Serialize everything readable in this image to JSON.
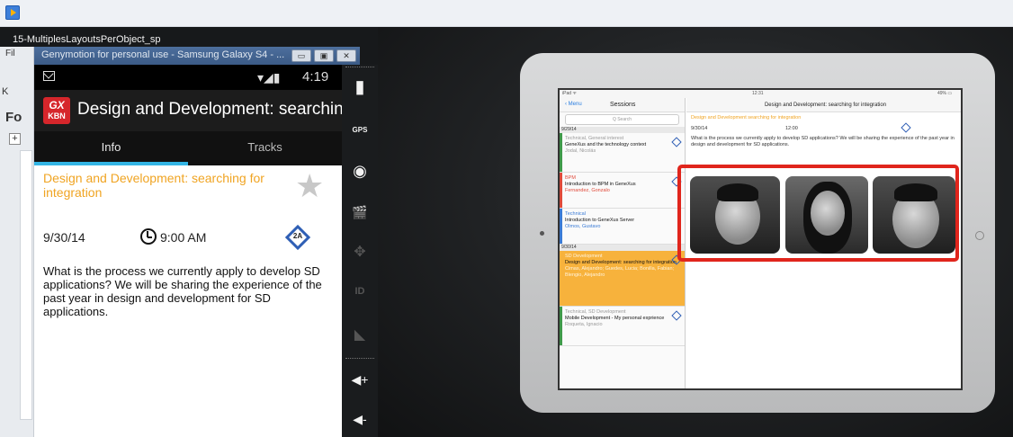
{
  "top_bar": {
    "app_icon": "video-player-icon"
  },
  "video_title": "15-MultiplesLayoutsPerObject_sp",
  "ide": {
    "file_menu": "Fil",
    "k_tab": "K",
    "fo_label": "Fo",
    "expand": "+"
  },
  "genymotion": {
    "window_title": "Genymotion for personal use - Samsung Galaxy S4 - ...",
    "buttons": [
      "▭",
      "▣",
      "✕"
    ]
  },
  "phone": {
    "status": {
      "time": "4:19",
      "signal": "▾◢▮"
    },
    "action_bar": {
      "logo_top": "GX",
      "logo_bottom": "KBN",
      "title": "Design and Development: searching..."
    },
    "tabs": [
      {
        "label": "Info",
        "active": true
      },
      {
        "label": "Tracks",
        "active": false
      }
    ],
    "session": {
      "title": "Design and Development: searching for integration",
      "date": "9/30/14",
      "time": "9:00 AM",
      "room": "2A",
      "description": "What is the process we currently apply to develop SD applications? We will be sharing the experience of the past year in design and development for SD applications."
    }
  },
  "side_controls": [
    {
      "name": "battery-icon",
      "glyph": "▮"
    },
    {
      "name": "gps-icon",
      "glyph": "GPS"
    },
    {
      "name": "camera-icon",
      "glyph": "◉"
    },
    {
      "name": "clapper-icon",
      "glyph": "🎬"
    },
    {
      "name": "dpad-icon",
      "glyph": "✥"
    },
    {
      "name": "id-icon",
      "glyph": "ID"
    },
    {
      "name": "rss-icon",
      "glyph": "◣"
    },
    {
      "name": "volume-up-icon",
      "glyph": "◀+"
    },
    {
      "name": "volume-down-icon",
      "glyph": "◀-"
    }
  ],
  "ipad": {
    "status": {
      "left": "iPad ᯤ",
      "center": "12:31",
      "right": "49% ▭"
    },
    "left_nav": {
      "back": "‹ Menu",
      "title": "Sessions"
    },
    "search_placeholder": "Q Search",
    "date_headers": [
      "9/29/14",
      "9/30/14"
    ],
    "items": [
      {
        "tag": "Technical, General interest",
        "name": "GeneXus and the technology context",
        "author": "Jodal, Nicolás",
        "color": "#3f9a4a",
        "selected": false
      },
      {
        "tag": "BPM",
        "name": "Introduction to BPM in GeneXus",
        "author": "Fernandez, Gonzalo",
        "color": "#e04a3a",
        "selected": false
      },
      {
        "tag": "Technical",
        "name": "Introduction to GeneXus Server",
        "author": "Olmos, Gustavo",
        "color": "#3a7bd5",
        "selected": false
      },
      {
        "tag": "SD Development",
        "name": "Design and Development: searching for integration",
        "author": "Cimas, Alejandro; Guedes, Lucia; Bonilla, Fabian; Blengio, Alejandro",
        "color": "#f7b23c",
        "selected": true
      },
      {
        "tag": "Technical, SD Development",
        "name": "Mobile Development - My personal exprience",
        "author": "Roqueta, Ignacio",
        "color": "#3f9a4a",
        "selected": false
      }
    ],
    "right_title": "Design and Development: searching for integration",
    "right_subtitle": "Design and Development searching for integration",
    "right_date": "9/30/14",
    "right_time": "12:00",
    "right_desc": "What is the process we currently apply to develop SD applications? We will be sharing the experience of the past year in design and development for SD applications."
  }
}
